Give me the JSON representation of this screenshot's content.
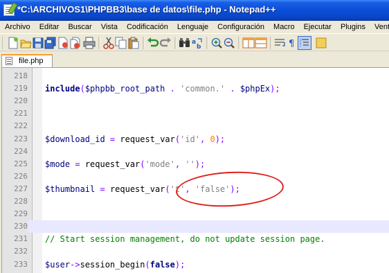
{
  "window": {
    "title": "*C:\\ARCHIVOS1\\PHPBB3\\base de datos\\file.php - Notepad++"
  },
  "menu": [
    "Archivo",
    "Editar",
    "Buscar",
    "Vista",
    "Codificación",
    "Lenguaje",
    "Configuración",
    "Macro",
    "Ejecutar",
    "Plugins",
    "Ventana"
  ],
  "toolbar": {
    "icons": [
      "new-file-icon",
      "open-file-icon",
      "save-icon",
      "save-all-icon",
      "close-icon",
      "close-all-icon",
      "print-icon",
      "cut-icon",
      "copy-icon",
      "paste-icon",
      "undo-icon",
      "redo-icon",
      "find-icon",
      "replace-icon",
      "zoom-in-icon",
      "zoom-out-icon",
      "sync-vertical-icon",
      "sync-horizontal-icon",
      "word-wrap-icon",
      "show-all-chars-icon",
      "indent-guide-icon"
    ]
  },
  "tabs": [
    {
      "label": "file.php",
      "active": true
    }
  ],
  "editor": {
    "current_line": 230,
    "lines": [
      {
        "num": "218",
        "tokens": []
      },
      {
        "num": "219",
        "tokens": [
          {
            "t": "include",
            "c": "kw"
          },
          {
            "t": "(",
            "c": "op"
          },
          {
            "t": "$phpbb_root_path",
            "c": "var"
          },
          {
            "t": " . ",
            "c": "op"
          },
          {
            "t": "'common.'",
            "c": "str"
          },
          {
            "t": " . ",
            "c": "op"
          },
          {
            "t": "$phpEx",
            "c": "var"
          },
          {
            "t": ");",
            "c": "op"
          }
        ]
      },
      {
        "num": "220",
        "tokens": []
      },
      {
        "num": "221",
        "tokens": []
      },
      {
        "num": "222",
        "tokens": []
      },
      {
        "num": "223",
        "tokens": [
          {
            "t": "$download_id",
            "c": "var"
          },
          {
            "t": " = ",
            "c": "op"
          },
          {
            "t": "request_var",
            "c": "fn"
          },
          {
            "t": "(",
            "c": "op"
          },
          {
            "t": "'id'",
            "c": "str"
          },
          {
            "t": ", ",
            "c": "op"
          },
          {
            "t": "0",
            "c": "num"
          },
          {
            "t": ");",
            "c": "op"
          }
        ]
      },
      {
        "num": "224",
        "tokens": []
      },
      {
        "num": "225",
        "tokens": [
          {
            "t": "$mode",
            "c": "var"
          },
          {
            "t": " = ",
            "c": "op"
          },
          {
            "t": "request_var",
            "c": "fn"
          },
          {
            "t": "(",
            "c": "op"
          },
          {
            "t": "'mode'",
            "c": "str"
          },
          {
            "t": ", ",
            "c": "op"
          },
          {
            "t": "''",
            "c": "str"
          },
          {
            "t": ");",
            "c": "op"
          }
        ]
      },
      {
        "num": "226",
        "tokens": []
      },
      {
        "num": "227",
        "tokens": [
          {
            "t": "$thumbnail",
            "c": "var"
          },
          {
            "t": " = ",
            "c": "op"
          },
          {
            "t": "request_var",
            "c": "fn"
          },
          {
            "t": "(",
            "c": "op"
          },
          {
            "t": "'t'",
            "c": "str"
          },
          {
            "t": ", ",
            "c": "op"
          },
          {
            "t": "'false'",
            "c": "str"
          },
          {
            "t": ");",
            "c": "op"
          }
        ]
      },
      {
        "num": "228",
        "tokens": []
      },
      {
        "num": "229",
        "tokens": []
      },
      {
        "num": "230",
        "tokens": []
      },
      {
        "num": "231",
        "tokens": [
          {
            "t": "// Start session management, do not update session page.",
            "c": "cm"
          }
        ]
      },
      {
        "num": "232",
        "tokens": []
      },
      {
        "num": "233",
        "tokens": [
          {
            "t": "$user",
            "c": "var"
          },
          {
            "t": "->",
            "c": "op"
          },
          {
            "t": "session_begin",
            "c": "fn"
          },
          {
            "t": "(",
            "c": "op"
          },
          {
            "t": "false",
            "c": "bool"
          },
          {
            "t": ");",
            "c": "op"
          }
        ]
      }
    ]
  }
}
